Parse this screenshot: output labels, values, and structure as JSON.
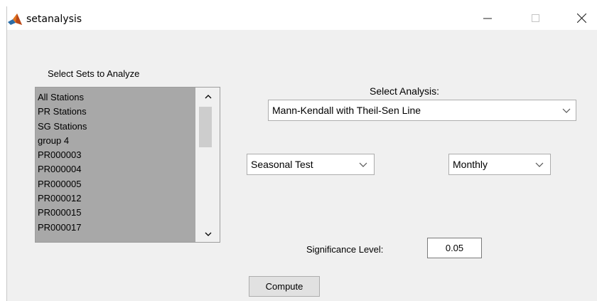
{
  "window": {
    "title": "setanalysis",
    "controls": {
      "minimize": "—",
      "maximize": "☐",
      "close": "✕"
    }
  },
  "sets_panel": {
    "label": "Select Sets to Analyze",
    "items": [
      {
        "label": "All Stations"
      },
      {
        "label": "PR Stations"
      },
      {
        "label": "SG Stations"
      },
      {
        "label": "group 4"
      },
      {
        "label": "PR000003"
      },
      {
        "label": "PR000004"
      },
      {
        "label": "PR000005"
      },
      {
        "label": "PR000012"
      },
      {
        "label": "PR000015"
      },
      {
        "label": "PR000017"
      }
    ]
  },
  "analysis": {
    "label": "Select Analysis:",
    "selected": "Mann-Kendall with Theil-Sen Line"
  },
  "test_type": {
    "selected": "Seasonal Test"
  },
  "period": {
    "selected": "Monthly"
  },
  "significance": {
    "label": "Significance Level:",
    "value": "0.05"
  },
  "compute": {
    "label": "Compute"
  },
  "colors": {
    "panel_bg": "#f0f0f0",
    "listbox_bg": "#a8a8a8",
    "button_bg": "#e1e1e1",
    "titlebar_bg": "#ffffff"
  }
}
